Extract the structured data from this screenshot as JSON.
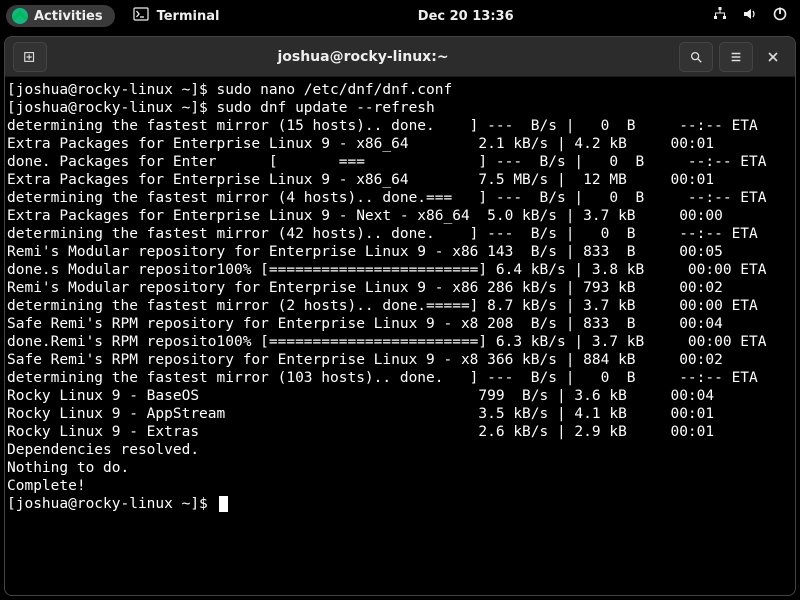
{
  "topbar": {
    "activities_label": "Activities",
    "app_label": "Terminal",
    "clock": "Dec 20  13:36"
  },
  "window": {
    "title": "joshua@rocky-linux:~"
  },
  "terminal": {
    "prompt": "[joshua@rocky-linux ~]$ ",
    "cmd1": "sudo nano /etc/dnf/dnf.conf",
    "cmd2": "sudo dnf update --refresh",
    "lines": [
      "determining the fastest mirror (15 hosts).. done.    ] ---  B/s |   0  B     --:-- ETA",
      "Extra Packages for Enterprise Linux 9 - x86_64        2.1 kB/s | 4.2 kB     00:01",
      "done. Packages for Enter      [       ===             ] ---  B/s |   0  B     --:-- ETA",
      "Extra Packages for Enterprise Linux 9 - x86_64        7.5 MB/s |  12 MB     00:01",
      "determining the fastest mirror (4 hosts).. done.===   ] ---  B/s |   0  B     --:-- ETA",
      "Extra Packages for Enterprise Linux 9 - Next - x86_64  5.0 kB/s | 3.7 kB     00:00",
      "determining the fastest mirror (42 hosts).. done.    ] ---  B/s |   0  B     --:-- ETA",
      "Remi's Modular repository for Enterprise Linux 9 - x86 143  B/s | 833  B     00:05",
      "done.s Modular repositor100% [========================] 6.4 kB/s | 3.8 kB     00:00 ETA",
      "Remi's Modular repository for Enterprise Linux 9 - x86 286 kB/s | 793 kB     00:02",
      "determining the fastest mirror (2 hosts).. done.=====] 8.7 kB/s | 3.7 kB     00:00 ETA",
      "Safe Remi's RPM repository for Enterprise Linux 9 - x8 208  B/s | 833  B     00:04",
      "done.Remi's RPM reposito100% [========================] 6.3 kB/s | 3.7 kB     00:00 ETA",
      "Safe Remi's RPM repository for Enterprise Linux 9 - x8 366 kB/s | 884 kB     00:02",
      "determining the fastest mirror (103 hosts).. done.   ] ---  B/s |   0  B     --:-- ETA",
      "Rocky Linux 9 - BaseOS                                799  B/s | 3.6 kB     00:04",
      "Rocky Linux 9 - AppStream                             3.5 kB/s | 4.1 kB     00:01",
      "Rocky Linux 9 - Extras                                2.6 kB/s | 2.9 kB     00:01",
      "Dependencies resolved.",
      "Nothing to do.",
      "Complete!"
    ]
  }
}
